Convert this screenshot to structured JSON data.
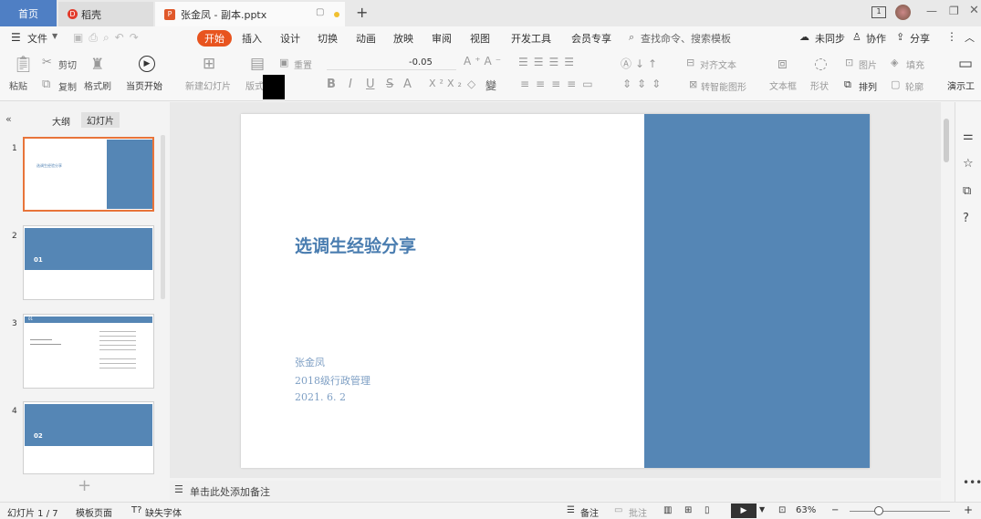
{
  "titlebar": {
    "tab_home": "首页",
    "tab_docer": "稻壳",
    "tab_file": "张金凤 - 副本.pptx",
    "add_tab": "+"
  },
  "menu": {
    "file": "文件",
    "items": [
      "开始",
      "插入",
      "设计",
      "切换",
      "动画",
      "放映",
      "审阅",
      "视图",
      "开发工具",
      "会员专享"
    ],
    "search": "查找命令、搜索模板",
    "unsynced": "未同步",
    "collab": "协作",
    "share": "分享"
  },
  "ribbon": {
    "paste": "粘贴",
    "cut": "剪切",
    "copy": "复制",
    "format_painter": "格式刷",
    "from_current": "当页开始",
    "new_slide": "新建幻灯片",
    "layout": "版式",
    "reset": "重置",
    "font_size": "-0.05",
    "align_text": "对齐文本",
    "smart_art": "转智能图形",
    "textbox": "文本框",
    "shape": "形状",
    "arrange": "排列",
    "picture": "图片",
    "fill": "填充",
    "outline": "轮廓",
    "presentation_tool": "演示工",
    "bold": "B",
    "italic": "I",
    "underline": "U",
    "strike": "S",
    "font_color": "A"
  },
  "left_panel": {
    "tab_outline": "大纲",
    "tab_slides": "幻灯片",
    "slides": [
      {
        "num": "1",
        "title": "选调生经验分享"
      },
      {
        "num": "2",
        "title": "01"
      },
      {
        "num": "3",
        "title": "01"
      },
      {
        "num": "4",
        "title": "02"
      }
    ],
    "add": "+"
  },
  "slide": {
    "title": "选调生经验分享",
    "author": "张金凤",
    "class": "2018级行政管理",
    "date": "2021. 6. 2"
  },
  "notes": {
    "placeholder": "单击此处添加备注"
  },
  "status": {
    "slide_count": "幻灯片 1 / 7",
    "template": "模板页面",
    "missing_font": "缺失字体",
    "notes": "备注",
    "comments": "批注",
    "zoom": "63%"
  },
  "colors": {
    "accent": "#e8541f",
    "slide_blue": "#5586b5",
    "title_blue": "#4a7db0",
    "home_tab": "#4f7fc4"
  }
}
